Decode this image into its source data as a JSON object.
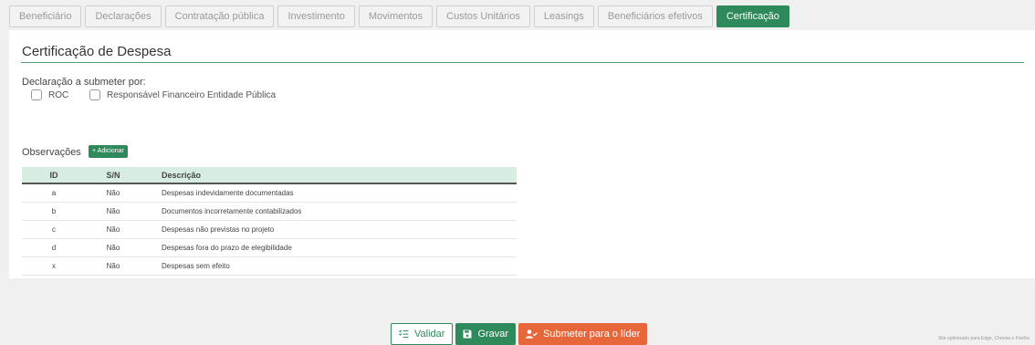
{
  "tabs": [
    {
      "label": "Beneficiário",
      "active": false
    },
    {
      "label": "Declarações",
      "active": false
    },
    {
      "label": "Contratação pública",
      "active": false
    },
    {
      "label": "Investimento",
      "active": false
    },
    {
      "label": "Movimentos",
      "active": false
    },
    {
      "label": "Custos Unitários",
      "active": false
    },
    {
      "label": "Leasings",
      "active": false
    },
    {
      "label": "Beneficiários efetivos",
      "active": false
    },
    {
      "label": "Certificação",
      "active": true
    }
  ],
  "page": {
    "title": "Certificação de Despesa",
    "declaration_label": "Declaração a submeter por:",
    "options": [
      {
        "label": "ROC",
        "checked": false
      },
      {
        "label": "Responsável Financeiro Entidade Pública",
        "checked": false
      }
    ]
  },
  "observations": {
    "label": "Observações",
    "add_label": "+ Adicionar",
    "columns": [
      "ID",
      "S/N",
      "Descrição"
    ],
    "rows": [
      {
        "id": "a",
        "sn": "Não",
        "desc": "Despesas indevidamente documentadas"
      },
      {
        "id": "b",
        "sn": "Não",
        "desc": "Documentos incorretamente contabilizados"
      },
      {
        "id": "c",
        "sn": "Não",
        "desc": "Despesas não previstas no projeto"
      },
      {
        "id": "d",
        "sn": "Não",
        "desc": "Despesas fora do prazo de elegibilidade"
      },
      {
        "id": "x",
        "sn": "Não",
        "desc": "Despesas sem efeito"
      }
    ]
  },
  "footer": {
    "validate_label": "Validar",
    "save_label": "Gravar",
    "submit_label": "Submeter para o líder",
    "note": "Site optimizado para Edge, Chrome e Firefox"
  },
  "colors": {
    "accent_green": "#2f8a5b",
    "header_row": "#d7ede2",
    "submit_orange": "#e8673a"
  },
  "icons": {
    "validate": "checklist-icon",
    "save": "floppy-disk-icon",
    "submit": "user-check-icon"
  }
}
